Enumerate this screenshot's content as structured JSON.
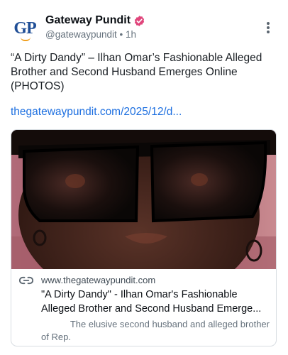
{
  "author": {
    "display_name": "Gateway Pundit",
    "handle": "@gatewaypundit",
    "separator": "•",
    "time_ago": "1h",
    "avatar_text": "GP"
  },
  "post": {
    "text": "“A Dirty Dandy” – Ilhan Omar’s Fashionable Alleged Brother and Second Husband Emerges Online (PHOTOS)",
    "link_text": "thegatewaypundit.com/2025/12/d..."
  },
  "card": {
    "domain": "www.thegatewaypundit.com",
    "title_line1": "\"A Dirty Dandy\" - Ilhan Omar's Fashionable",
    "title_line2": "Alleged Brother and Second Husband Emerge...",
    "description_line1": "The elusive second husband and alleged brother",
    "description_line2": "of Rep.",
    "image_subject": "close-up photo of a man wearing black sunglasses"
  },
  "colors": {
    "verified_badge": "#e0457b",
    "link": "#1d6fe0",
    "muted_text": "#66727d",
    "avatar_brand": "#1f4e96",
    "avatar_accent": "#f0a020"
  },
  "icons": [
    "verified-badge-icon",
    "more-vertical-icon",
    "link-icon"
  ]
}
